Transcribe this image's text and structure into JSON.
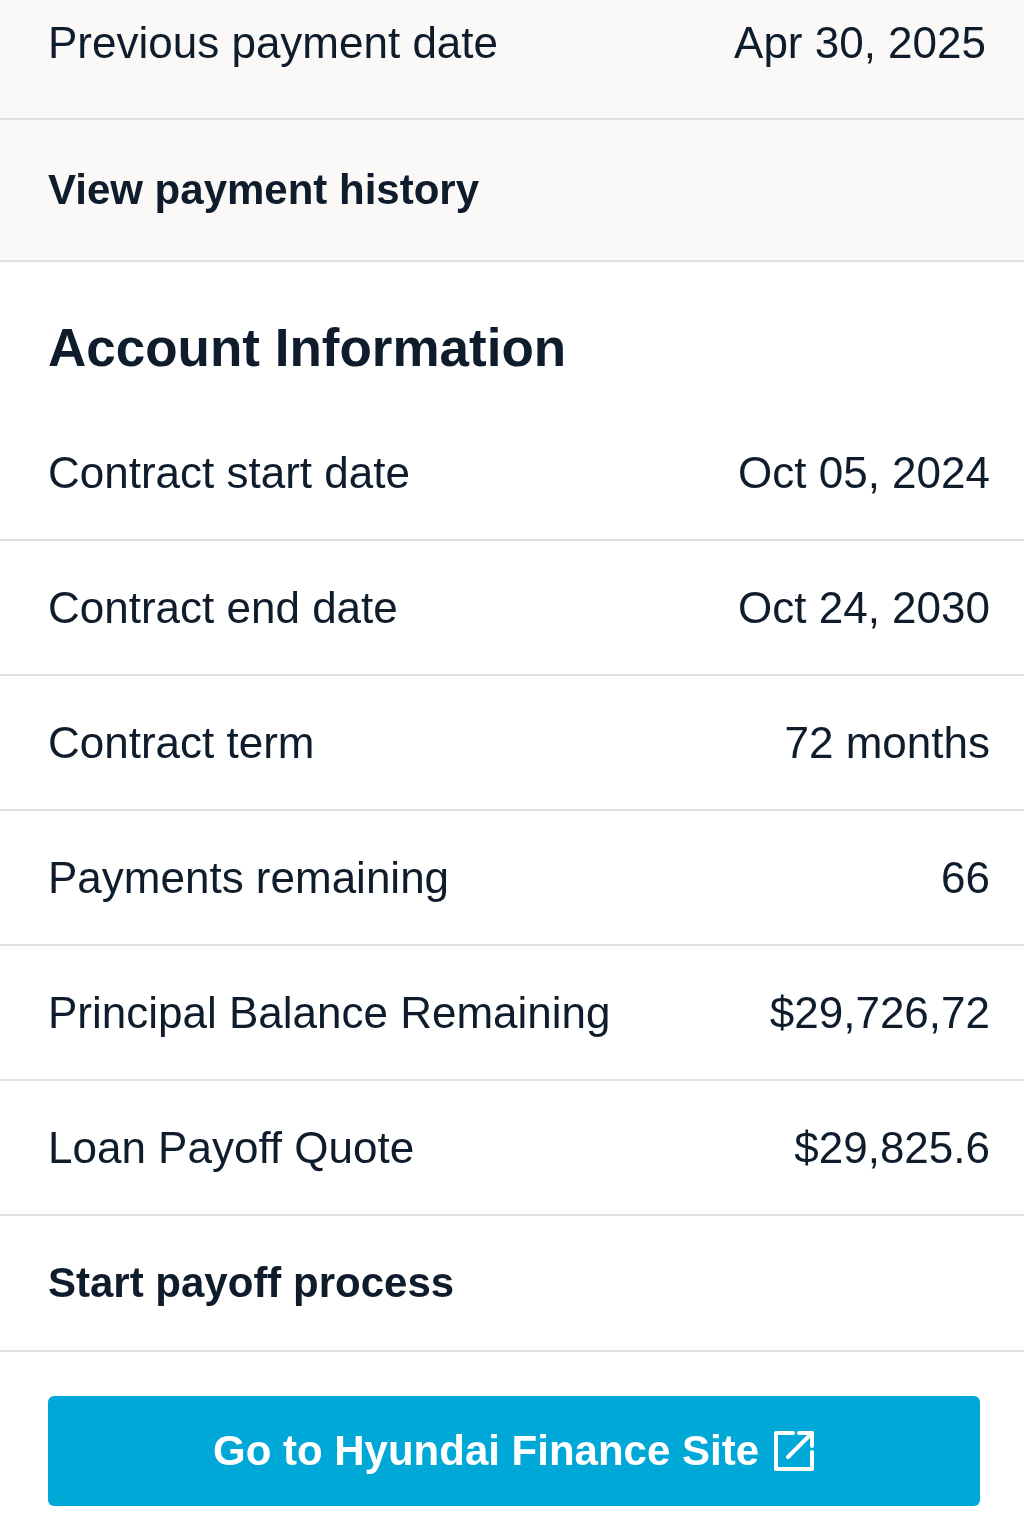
{
  "payment_rows": [
    {
      "label": "Previous payment date",
      "value": "Apr 30, 2025"
    }
  ],
  "payment_link": {
    "label": "View payment history"
  },
  "account": {
    "title": "Account Information",
    "rows": [
      {
        "label": "Contract start date",
        "value": "Oct 05, 2024"
      },
      {
        "label": "Contract end date",
        "value": "Oct 24, 2030"
      },
      {
        "label": "Contract term",
        "value": "72 months"
      },
      {
        "label": "Payments remaining",
        "value": "66"
      },
      {
        "label": "Principal Balance Remaining",
        "value": "$29,726,72"
      },
      {
        "label": "Loan Payoff Quote",
        "value": "$29,825.6"
      }
    ],
    "link": {
      "label": "Start payoff process"
    }
  },
  "button": {
    "label": "Go to Hyundai Finance Site"
  }
}
